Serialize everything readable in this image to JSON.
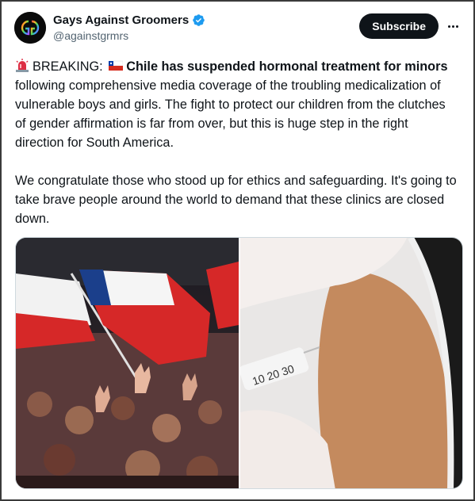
{
  "account": {
    "display_name": "Gays Against Groomers",
    "handle": "@againstgrmrs",
    "verified": true
  },
  "actions": {
    "subscribe_label": "Subscribe",
    "more_icon": "more-horizontal-icon"
  },
  "tweet": {
    "paragraph1": {
      "siren_emoji": "rotating-light-icon",
      "prefix": "BREAKING:",
      "flag_emoji": "chile-flag-icon",
      "bold_text": "Chile has suspended hormonal treatment for minors",
      "rest": " following comprehensive media coverage of the troubling medicalization of vulnerable boys and girls. The fight to protect our children from the clutches of gender affirmation is far from over, but this is huge step in the right direction for South America."
    },
    "paragraph2": "We congratulate those who stood up for ethics and safeguarding. It's going to take brave people around the world to demand that these clinics are closed down."
  },
  "media": {
    "image1": "crowd-with-chilean-flags-photo",
    "image2": "syringe-injection-in-arm-photo"
  },
  "colors": {
    "text": "#0f1419",
    "secondary": "#536471",
    "verified_blue": "#1d9bf0",
    "button_bg": "#0f1419"
  }
}
